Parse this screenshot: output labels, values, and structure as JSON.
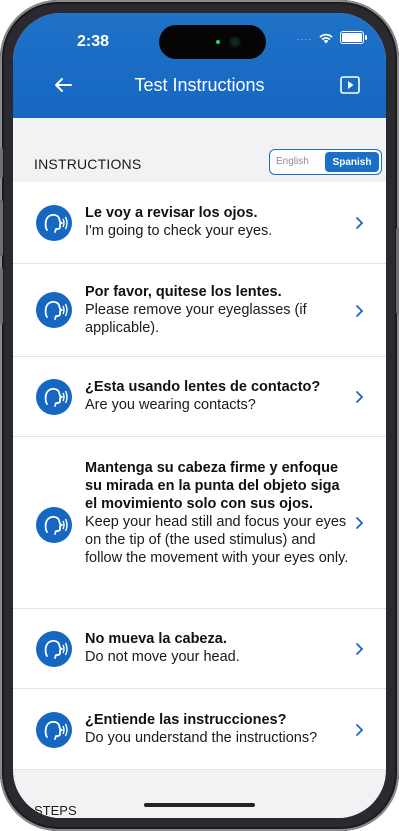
{
  "status_bar": {
    "time": "2:38",
    "signal": "...."
  },
  "header": {
    "title": "Test Instructions"
  },
  "section": {
    "title": "INSTRUCTIONS"
  },
  "language_toggle": {
    "english": "English",
    "spanish": "Spanish",
    "selected": "Spanish"
  },
  "instructions": [
    {
      "spanish": "Le voy a revisar los ojos.",
      "english": "I'm going to check your eyes."
    },
    {
      "spanish": "Por favor, quitese los lentes.",
      "english": "Please remove your eyeglasses (if applicable)."
    },
    {
      "spanish": "¿Esta usando lentes de contacto?",
      "english": "Are you wearing contacts?"
    },
    {
      "spanish": "Mantenga su cabeza firme y enfoque su mirada en la punta del objeto siga el movimiento solo con sus ojos.",
      "english": "Keep your head still and focus your eyes on the tip of (the used stimulus) and follow the movement with your eyes only."
    },
    {
      "spanish": "No mueva la cabeza.",
      "english": "Do not move your head."
    },
    {
      "spanish": "¿Entiende las instrucciones?",
      "english": "Do you understand the instructions?"
    }
  ],
  "next_section": {
    "title": "STEPS"
  },
  "colors": {
    "brand": "#1567c2",
    "background": "#f2f2f4"
  },
  "icons": [
    "back-arrow-icon",
    "play-icon",
    "speaking-head-icon",
    "chevron-right-icon"
  ]
}
